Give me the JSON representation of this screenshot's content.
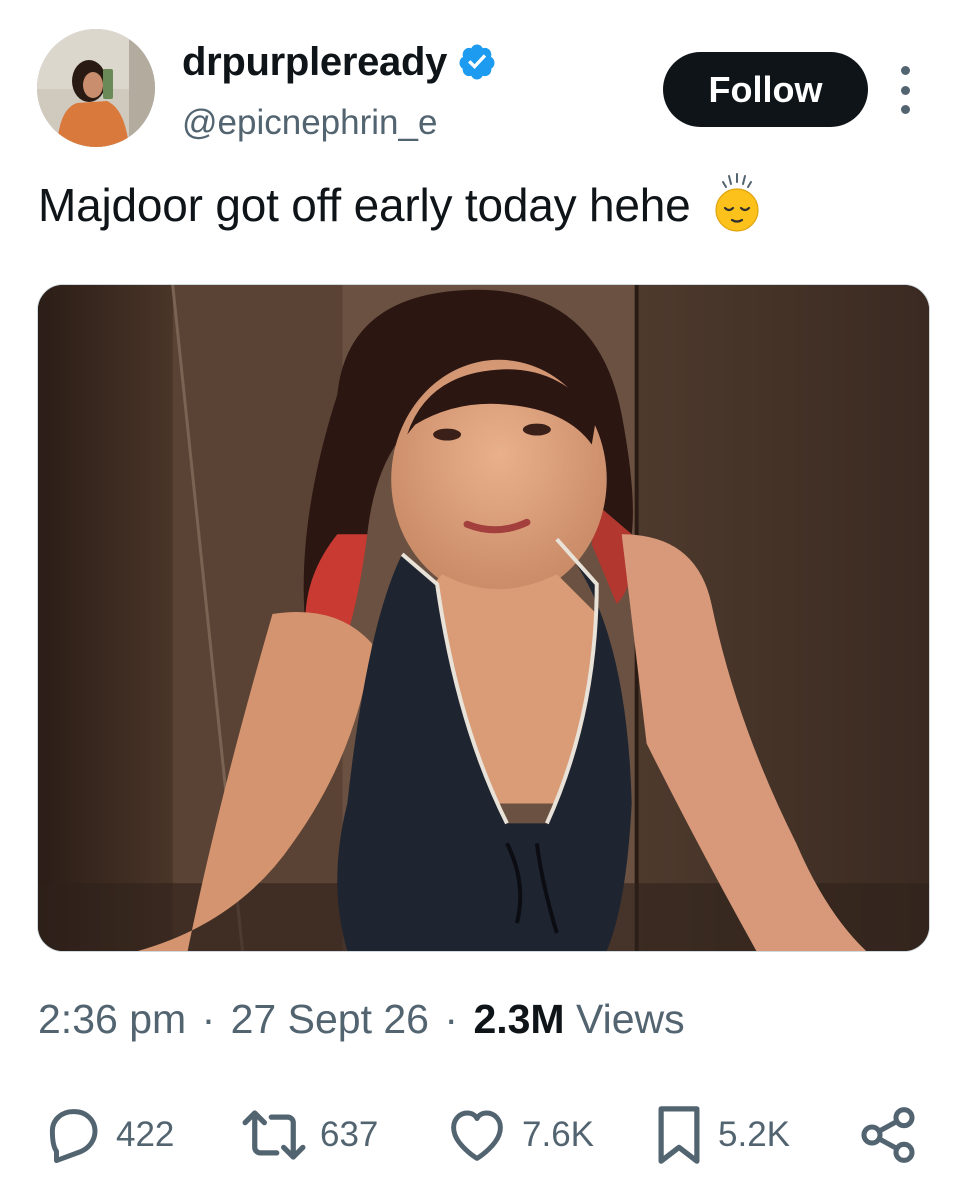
{
  "author": {
    "display_name": "drpurpleready",
    "handle": "@epicnephrin_e",
    "verified": true,
    "verified_color": "#1d9bf0"
  },
  "header": {
    "follow_label": "Follow",
    "more_icon": "more-vertical-icon"
  },
  "tweet": {
    "text": "Majdoor got off early today hehe",
    "emoji": "pensive-face-emoji"
  },
  "meta": {
    "time": "2:36 pm",
    "separator": "·",
    "date": "27 Sept 26",
    "views_count": "2.3M",
    "views_label": "Views"
  },
  "actions": {
    "replies": "422",
    "reposts": "637",
    "likes": "7.6K",
    "bookmarks": "5.2K",
    "icons": [
      "reply-icon",
      "repost-icon",
      "like-icon",
      "bookmark-icon",
      "share-icon"
    ]
  },
  "colors": {
    "text_primary": "#0f1419",
    "text_secondary": "#536471",
    "follow_bg": "#0f1419",
    "follow_text": "#ffffff"
  }
}
